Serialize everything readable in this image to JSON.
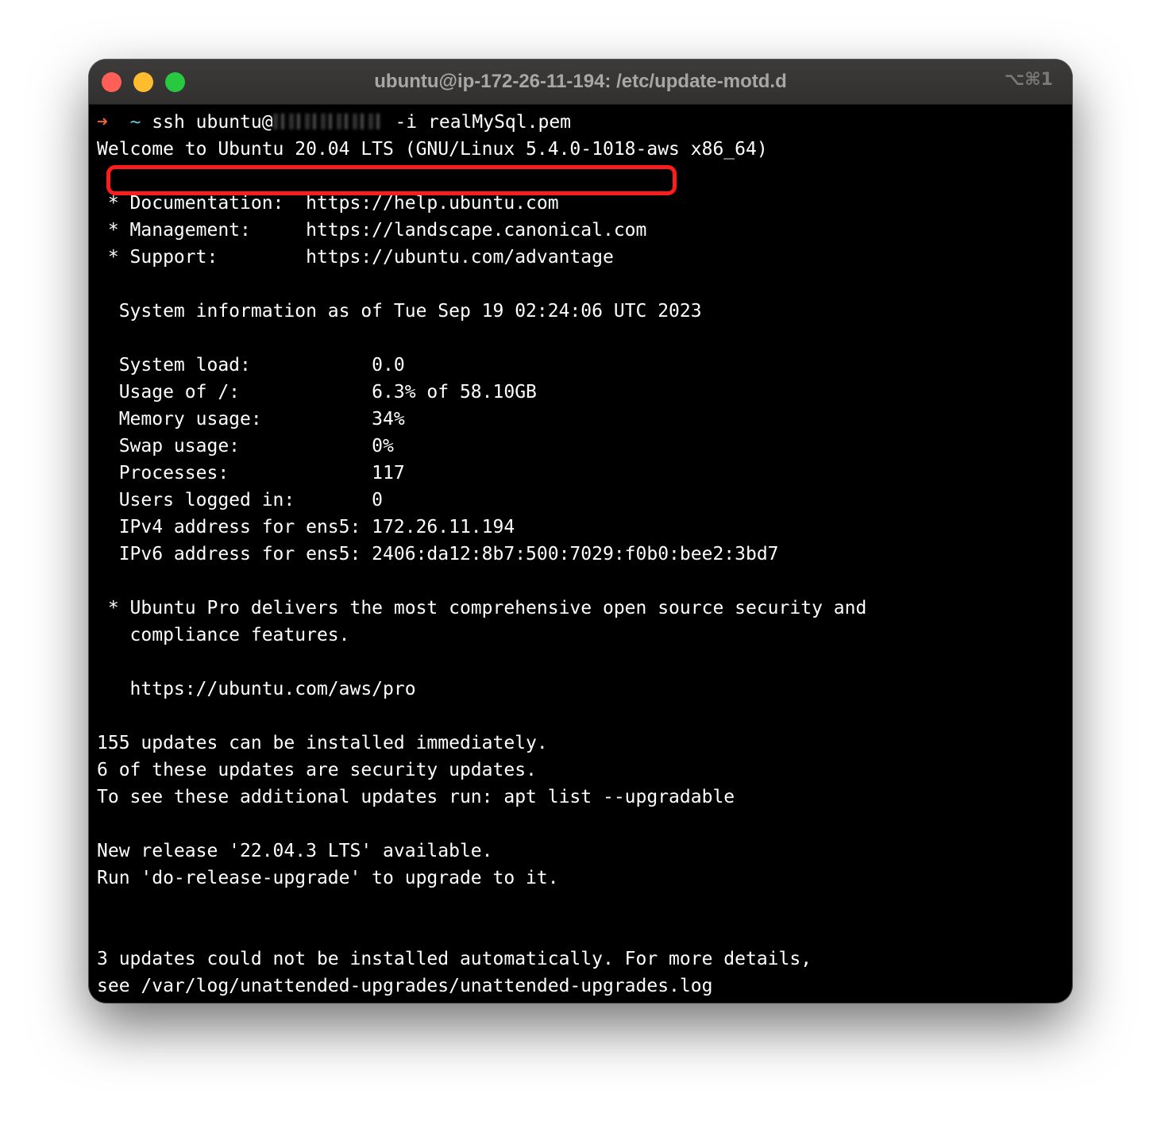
{
  "window": {
    "title": "ubuntu@ip-172-26-11-194: /etc/update-motd.d",
    "shortcut": "⌥⌘1"
  },
  "prompt": {
    "arrow": "➜",
    "cwd": "~",
    "command_start": "ssh ubuntu@",
    "command_end": " -i realMySql.pem"
  },
  "output": [
    "Welcome to Ubuntu 20.04 LTS (GNU/Linux 5.4.0-1018-aws x86_64)",
    "",
    " * Documentation:  https://help.ubuntu.com",
    " * Management:     https://landscape.canonical.com",
    " * Support:        https://ubuntu.com/advantage",
    "",
    "  System information as of Tue Sep 19 02:24:06 UTC 2023",
    "",
    "  System load:           0.0",
    "  Usage of /:            6.3% of 58.10GB",
    "  Memory usage:          34%",
    "  Swap usage:            0%",
    "  Processes:             117",
    "  Users logged in:       0",
    "  IPv4 address for ens5: 172.26.11.194",
    "  IPv6 address for ens5: 2406:da12:8b7:500:7029:f0b0:bee2:3bd7",
    "",
    " * Ubuntu Pro delivers the most comprehensive open source security and",
    "   compliance features.",
    "",
    "   https://ubuntu.com/aws/pro",
    "",
    "155 updates can be installed immediately.",
    "6 of these updates are security updates.",
    "To see these additional updates run: apt list --upgradable",
    "",
    "New release '22.04.3 LTS' available.",
    "Run 'do-release-upgrade' to upgrade to it.",
    "",
    "",
    "3 updates could not be installed automatically. For more details,",
    "see /var/log/unattended-upgrades/unattended-upgrades.log"
  ],
  "colors": {
    "highlight": "#ff1c1c",
    "prompt_arrow": "#e8643c",
    "prompt_cwd": "#61c8d8"
  }
}
